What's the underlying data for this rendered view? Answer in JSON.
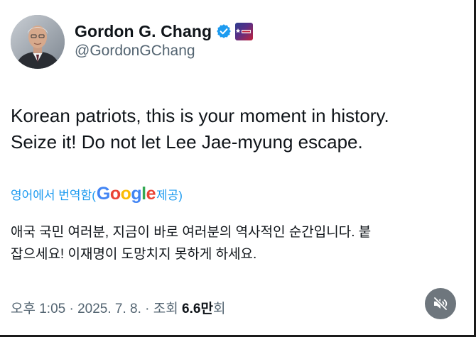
{
  "author": {
    "name": "Gordon G. Chang",
    "handle": "@GordonGChang",
    "avatar_icon": "profile-photo",
    "verified_icon": "verified-checkmark-icon",
    "affiliation_icon": "cpac-affiliation-badge"
  },
  "tweet": {
    "text_lines": [
      "Korean patriots, this is your moment in history.",
      "Seize it! Do not let Lee Jae-myung escape."
    ]
  },
  "translation": {
    "link_text": "영어에서 번역함(",
    "provider": "Google",
    "suffix": " 제공)",
    "text_lines": [
      "애국 국민 여러분, 지금이 바로 여러분의 역사적인 순간입니다. 붙",
      "잡으세요! 이재명이 도망치지 못하게 하세요."
    ]
  },
  "meta": {
    "time_date": "오후 1:05 · 2025. 7. 8. · 조회 ",
    "views_count": "6.6만",
    "views_suffix": "회"
  },
  "mute_icon": "speaker-muted-icon",
  "colors": {
    "link": "#1d9bf0",
    "secondary_text": "#536471",
    "primary_text": "#0f1419",
    "verified": "#1d9bf0"
  }
}
